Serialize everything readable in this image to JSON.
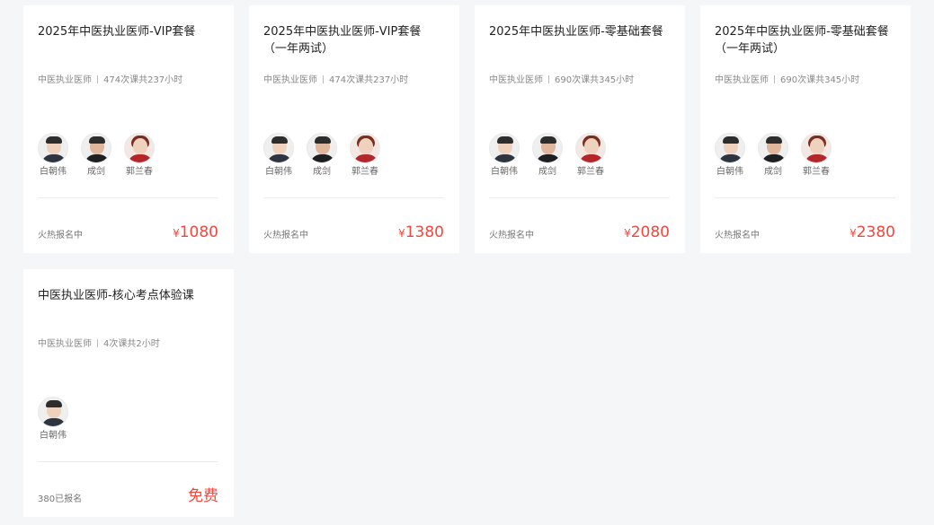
{
  "courses": [
    {
      "title": "2025年中医执业医师-VIP套餐",
      "category": "中医执业医师",
      "lessons": "474次课共237小时",
      "teachers": [
        "白朝伟",
        "成剑",
        "郭兰春"
      ],
      "status": "火热报名中",
      "currency": "¥",
      "price": "1080"
    },
    {
      "title": "2025年中医执业医师-VIP套餐（一年两试）",
      "category": "中医执业医师",
      "lessons": "474次课共237小时",
      "teachers": [
        "白朝伟",
        "成剑",
        "郭兰春"
      ],
      "status": "火热报名中",
      "currency": "¥",
      "price": "1380"
    },
    {
      "title": "2025年中医执业医师-零基础套餐",
      "category": "中医执业医师",
      "lessons": "690次课共345小时",
      "teachers": [
        "白朝伟",
        "成剑",
        "郭兰春"
      ],
      "status": "火热报名中",
      "currency": "¥",
      "price": "2080"
    },
    {
      "title": "2025年中医执业医师-零基础套餐（一年两试）",
      "category": "中医执业医师",
      "lessons": "690次课共345小时",
      "teachers": [
        "白朝伟",
        "成剑",
        "郭兰春"
      ],
      "status": "火热报名中",
      "currency": "¥",
      "price": "2380"
    },
    {
      "title": "中医执业医师-核心考点体验课",
      "category": "中医执业医师",
      "lessons": "4次课共2小时",
      "teachers": [
        "白朝伟"
      ],
      "status": "380已报名",
      "currency": "",
      "price": "免费"
    }
  ],
  "colors": {
    "price": "#f0483e",
    "background": "#f5f6f8",
    "card": "#ffffff"
  }
}
